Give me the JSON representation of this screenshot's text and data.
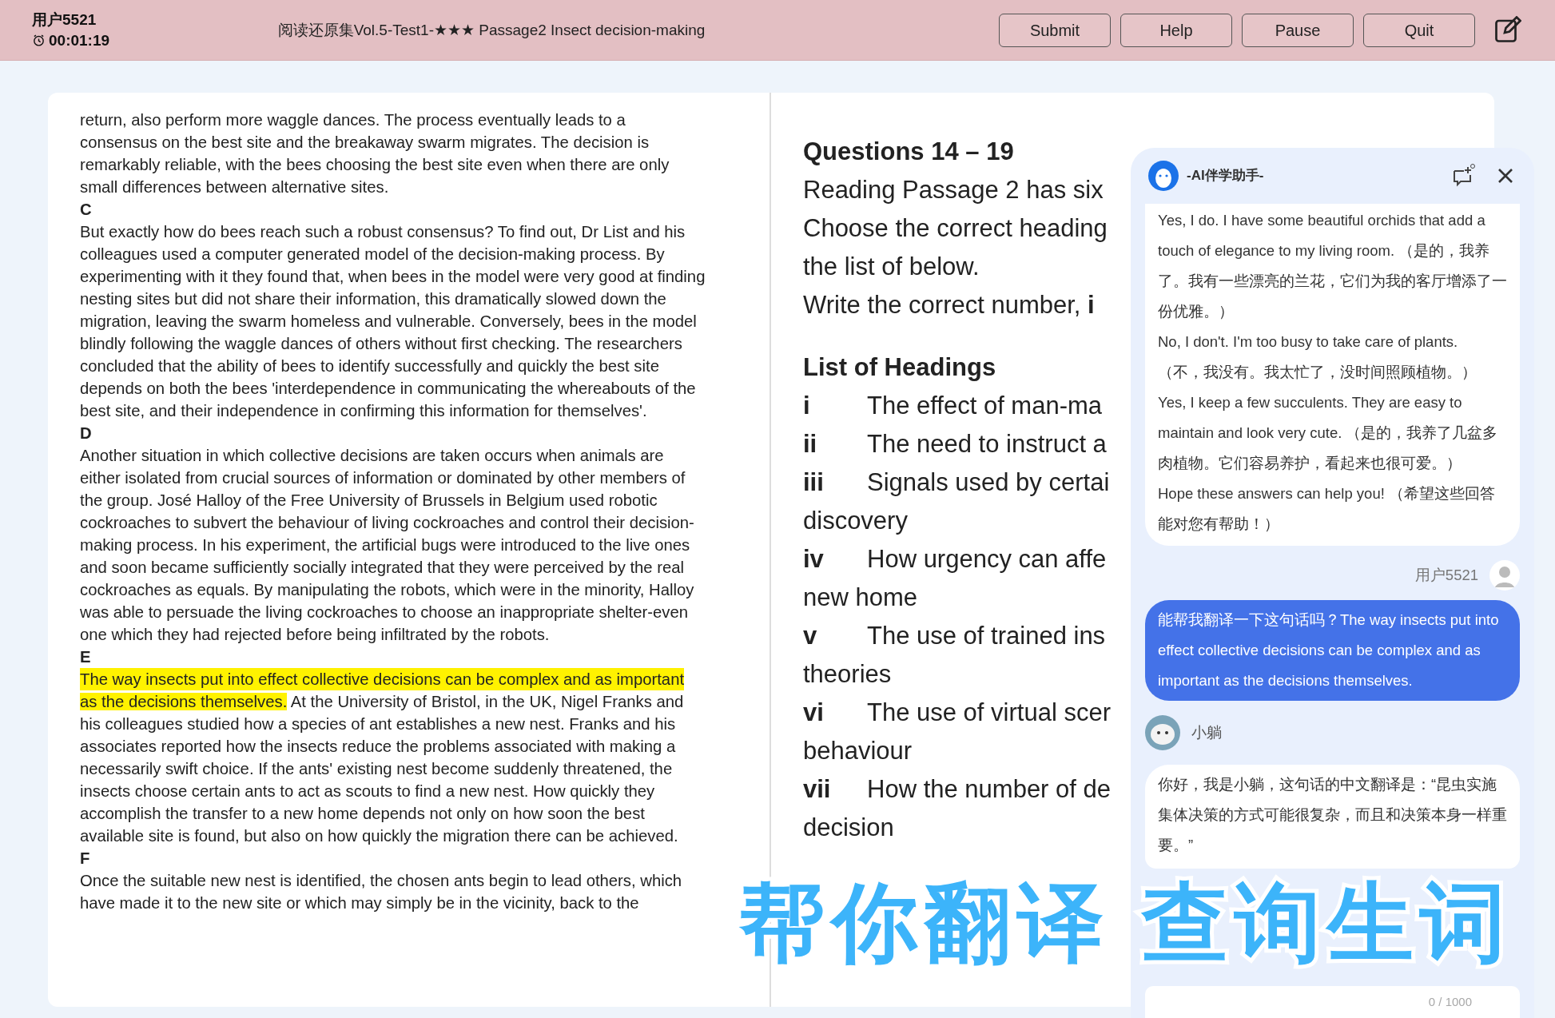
{
  "header": {
    "user": "用户5521",
    "timer": "00:01:19",
    "title": "阅读还原集Vol.5-Test1-★★★ Passage2 Insect decision-making",
    "buttons": [
      "Submit",
      "Help",
      "Pause",
      "Quit"
    ]
  },
  "passage": [
    {
      "kind": "paragraph",
      "segments": [
        {
          "text": "return, also perform more waggle dances. The process eventually leads to a consensus on the best site and the breakaway swarm migrates. The decision is remarkably reliable, with the bees choosing the best site even when there are only small differences between alternative sites.",
          "highlighted": false
        }
      ]
    },
    {
      "kind": "heading",
      "text": "C"
    },
    {
      "kind": "paragraph",
      "segments": [
        {
          "text": "But exactly how do bees reach such a robust consensus? To find out, Dr List and his colleagues used a computer generated model of the decision-making process. By experimenting with it they found that, when bees in the model were very good at finding nesting sites but did not share their information, this dramatically slowed down the migration, leaving the swarm homeless and vulnerable. Conversely, bees in the model blindly following the waggle dances of others without first checking. The researchers concluded that the ability of bees to identify successfully and quickly the best site depends on both the bees 'interdependence in communicating the whereabouts of the best site, and their independence in confirming this information for themselves'.",
          "highlighted": false
        }
      ]
    },
    {
      "kind": "heading",
      "text": "D"
    },
    {
      "kind": "paragraph",
      "segments": [
        {
          "text": "Another situation in which collective decisions are taken occurs when animals are either isolated from crucial sources of information or dominated by other members of the group. José Halloy of the Free University of Brussels in Belgium used robotic cockroaches to subvert the behaviour of living cockroaches and control their decision-making process. In his experiment, the artificial bugs were introduced to the live ones and soon became sufficiently socially integrated that they were perceived by the real cockroaches as equals. By manipulating the robots, which were in the minority, Halloy was able to persuade the living cockroaches to choose an inappropriate shelter-even one which they had rejected before being infiltrated by the robots.",
          "highlighted": false
        }
      ]
    },
    {
      "kind": "heading",
      "text": "E"
    },
    {
      "kind": "paragraph",
      "segments": [
        {
          "text": "The way insects put into effect collective decisions can be complex and as important",
          "highlighted": true
        },
        {
          "text": "as the decisions themselves.",
          "highlighted": true
        },
        {
          "text": " At the University of Bristol, in the UK, Nigel Franks and",
          "highlighted": false,
          "line_end": true
        },
        {
          "text": "his colleagues studied how a species of ant establishes a new nest. Franks and his associates reported how the insects reduce the problems associated with making a necessarily swift choice. If the ants' existing nest become suddenly threatened, the insects choose certain ants to act as scouts to find a new nest. How quickly they accomplish the transfer to a new home depends not only on how soon the best available site is found, but also on how quickly the migration there can be achieved.",
          "highlighted": false
        }
      ]
    },
    {
      "kind": "heading",
      "text": "F"
    },
    {
      "kind": "paragraph",
      "segments": [
        {
          "text": "Once the suitable new nest is identified, the chosen ants begin to lead others, which have made it to the new site or which may simply be in the vicinity, back to the",
          "highlighted": false
        }
      ]
    }
  ],
  "questions": {
    "title": "Questions 14 – 19",
    "instructions": [
      "Reading Passage 2 has six",
      "Choose the correct heading",
      "the list of below.",
      "Write the correct number, **i**"
    ],
    "headings_title": "List of Headings",
    "headings": [
      {
        "numeral": "i",
        "text": "The effect of man-ma"
      },
      {
        "numeral": "ii",
        "text": "The need to instruct a"
      },
      {
        "numeral": "iii",
        "text": "Signals used by certai",
        "continuation": "discovery"
      },
      {
        "numeral": "iv",
        "text": "How urgency can affe",
        "continuation": "new home"
      },
      {
        "numeral": "v",
        "text": "The use of trained ins",
        "continuation": "theories"
      },
      {
        "numeral": "vi",
        "text": "The use of virtual scer",
        "continuation": "behaviour"
      },
      {
        "numeral": "vii",
        "text": "How the number of de",
        "continuation": "decision"
      }
    ]
  },
  "chat": {
    "title": "-AI伴学助手-",
    "messages": [
      {
        "kind": "assistant",
        "lines": [
          "Yes, I do. I have some beautiful orchids that add a touch of elegance to my living room. （是的，我养了。我有一些漂亮的兰花，它们为我的客厅增添了一份优雅。）",
          "No, I don't. I'm too busy to take care of plants. （不，我没有。我太忙了，没时间照顾植物。）",
          "Yes, I keep a few succulents. They are easy to maintain and look very cute. （是的，我养了几盆多肉植物。它们容易养护，看起来也很可爱。）",
          "Hope these answers can help you! （希望这些回答能对您有帮助！）"
        ]
      },
      {
        "kind": "user",
        "sender": "用户5521",
        "lines": [
          "能帮我翻译一下这句话吗？The way insects put into effect collective decisions can be complex and as important as the decisions themselves."
        ]
      },
      {
        "kind": "bot",
        "sender": "小躺",
        "lines": [
          "你好，我是小躺，这句话的中文翻译是：“昆虫实施集体决策的方式可能很复杂，而且和决策本身一样重要。”"
        ]
      }
    ],
    "counter": "0 / 1000"
  },
  "caption": [
    "帮你翻译",
    "查询生词"
  ]
}
